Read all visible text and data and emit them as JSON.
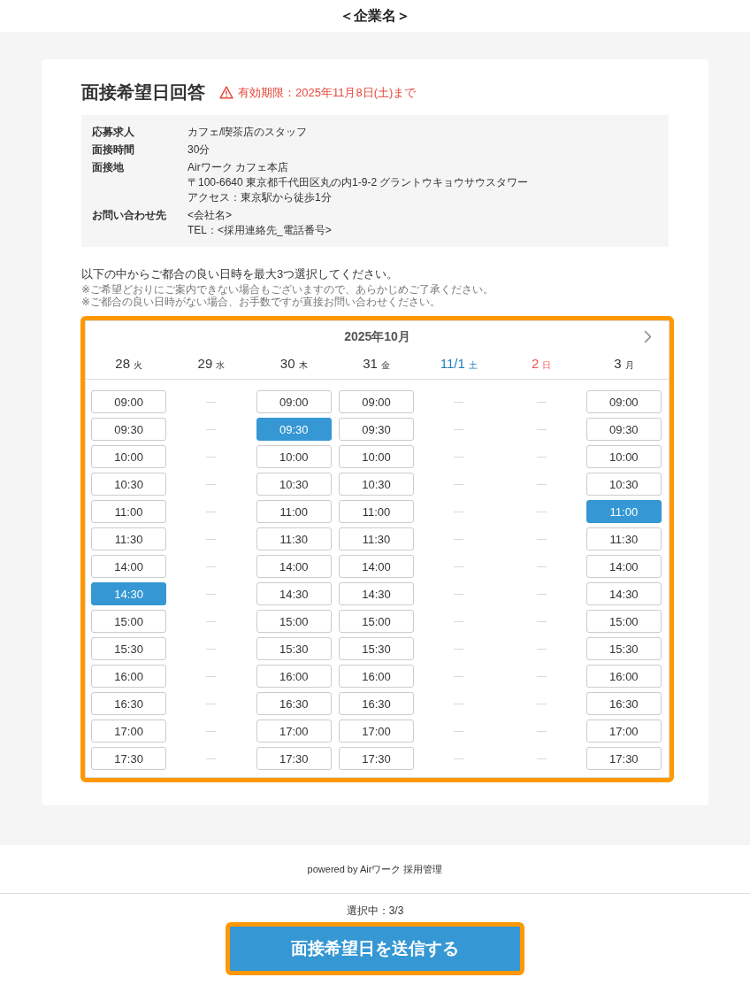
{
  "header": {
    "title": "＜企業名＞"
  },
  "form": {
    "title": "面接希望日回答",
    "deadline": "有効期限：2025年11月8日(土)まで",
    "details": [
      {
        "label": "応募求人",
        "lines": [
          "カフェ/喫茶店のスタッフ"
        ]
      },
      {
        "label": "面接時間",
        "lines": [
          "30分"
        ]
      },
      {
        "label": "面接地",
        "lines": [
          "Airワーク カフェ本店",
          "〒100-6640 東京都千代田区丸の内1-9-2 グラントウキョウサウスタワー",
          "アクセス：東京駅から徒歩1分"
        ]
      },
      {
        "label": "お問い合わせ先",
        "lines": [
          "<会社名>",
          "TEL：<採用連絡先_電話番号>"
        ]
      }
    ],
    "instruction": "以下の中からご都合の良い日時を最大3つ選択してください。",
    "notes": [
      "※ご希望どおりにご案内できない場合もございますので、あらかじめご了承ください。",
      "※ご都合の良い日時がない場合、お手数ですが直接お問い合わせください。"
    ],
    "calendar": {
      "highlighted": true,
      "month": "2025年10月",
      "days": [
        {
          "date": "28",
          "weekday": "火",
          "color": "#333333",
          "slots": [
            {
              "kind": "time",
              "time": "09:00",
              "selected": false
            },
            {
              "kind": "time",
              "time": "09:30",
              "selected": false
            },
            {
              "kind": "time",
              "time": "10:00",
              "selected": false
            },
            {
              "kind": "time",
              "time": "10:30",
              "selected": false
            },
            {
              "kind": "time",
              "time": "11:00",
              "selected": false
            },
            {
              "kind": "time",
              "time": "11:30",
              "selected": false
            },
            {
              "kind": "time",
              "time": "14:00",
              "selected": false
            },
            {
              "kind": "time",
              "time": "14:30",
              "selected": true
            },
            {
              "kind": "time",
              "time": "15:00",
              "selected": false
            },
            {
              "kind": "time",
              "time": "15:30",
              "selected": false
            },
            {
              "kind": "time",
              "time": "16:00",
              "selected": false
            },
            {
              "kind": "time",
              "time": "16:30",
              "selected": false
            },
            {
              "kind": "time",
              "time": "17:00",
              "selected": false
            },
            {
              "kind": "time",
              "time": "17:30",
              "selected": false
            }
          ]
        },
        {
          "date": "29",
          "weekday": "水",
          "color": "#333333",
          "slots": [
            {
              "kind": "none"
            },
            {
              "kind": "none"
            },
            {
              "kind": "none"
            },
            {
              "kind": "none"
            },
            {
              "kind": "none"
            },
            {
              "kind": "none"
            },
            {
              "kind": "none"
            },
            {
              "kind": "none"
            },
            {
              "kind": "none"
            },
            {
              "kind": "none"
            },
            {
              "kind": "none"
            },
            {
              "kind": "none"
            },
            {
              "kind": "none"
            },
            {
              "kind": "none"
            }
          ]
        },
        {
          "date": "30",
          "weekday": "木",
          "color": "#333333",
          "slots": [
            {
              "kind": "time",
              "time": "09:00",
              "selected": false
            },
            {
              "kind": "time",
              "time": "09:30",
              "selected": true
            },
            {
              "kind": "time",
              "time": "10:00",
              "selected": false
            },
            {
              "kind": "time",
              "time": "10:30",
              "selected": false
            },
            {
              "kind": "time",
              "time": "11:00",
              "selected": false
            },
            {
              "kind": "time",
              "time": "11:30",
              "selected": false
            },
            {
              "kind": "time",
              "time": "14:00",
              "selected": false
            },
            {
              "kind": "time",
              "time": "14:30",
              "selected": false
            },
            {
              "kind": "time",
              "time": "15:00",
              "selected": false
            },
            {
              "kind": "time",
              "time": "15:30",
              "selected": false
            },
            {
              "kind": "time",
              "time": "16:00",
              "selected": false
            },
            {
              "kind": "time",
              "time": "16:30",
              "selected": false
            },
            {
              "kind": "time",
              "time": "17:00",
              "selected": false
            },
            {
              "kind": "time",
              "time": "17:30",
              "selected": false
            }
          ]
        },
        {
          "date": "31",
          "weekday": "金",
          "color": "#333333",
          "slots": [
            {
              "kind": "time",
              "time": "09:00",
              "selected": false
            },
            {
              "kind": "time",
              "time": "09:30",
              "selected": false
            },
            {
              "kind": "time",
              "time": "10:00",
              "selected": false
            },
            {
              "kind": "time",
              "time": "10:30",
              "selected": false
            },
            {
              "kind": "time",
              "time": "11:00",
              "selected": false
            },
            {
              "kind": "time",
              "time": "11:30",
              "selected": false
            },
            {
              "kind": "time",
              "time": "14:00",
              "selected": false
            },
            {
              "kind": "time",
              "time": "14:30",
              "selected": false
            },
            {
              "kind": "time",
              "time": "15:00",
              "selected": false
            },
            {
              "kind": "time",
              "time": "15:30",
              "selected": false
            },
            {
              "kind": "time",
              "time": "16:00",
              "selected": false
            },
            {
              "kind": "time",
              "time": "16:30",
              "selected": false
            },
            {
              "kind": "time",
              "time": "17:00",
              "selected": false
            },
            {
              "kind": "time",
              "time": "17:30",
              "selected": false
            }
          ]
        },
        {
          "date": "11/1",
          "weekday": "土",
          "color": "#1f7cc0",
          "slots": [
            {
              "kind": "none"
            },
            {
              "kind": "none"
            },
            {
              "kind": "none"
            },
            {
              "kind": "none"
            },
            {
              "kind": "none"
            },
            {
              "kind": "none"
            },
            {
              "kind": "none"
            },
            {
              "kind": "none"
            },
            {
              "kind": "none"
            },
            {
              "kind": "none"
            },
            {
              "kind": "none"
            },
            {
              "kind": "none"
            },
            {
              "kind": "none"
            },
            {
              "kind": "none"
            }
          ]
        },
        {
          "date": "2",
          "weekday": "日",
          "color": "#ef5350",
          "slots": [
            {
              "kind": "none"
            },
            {
              "kind": "none"
            },
            {
              "kind": "none"
            },
            {
              "kind": "none"
            },
            {
              "kind": "none"
            },
            {
              "kind": "none"
            },
            {
              "kind": "none"
            },
            {
              "kind": "none"
            },
            {
              "kind": "none"
            },
            {
              "kind": "none"
            },
            {
              "kind": "none"
            },
            {
              "kind": "none"
            },
            {
              "kind": "none"
            },
            {
              "kind": "none"
            }
          ]
        },
        {
          "date": "3",
          "weekday": "月",
          "color": "#333333",
          "slots": [
            {
              "kind": "time",
              "time": "09:00",
              "selected": false
            },
            {
              "kind": "time",
              "time": "09:30",
              "selected": false
            },
            {
              "kind": "time",
              "time": "10:00",
              "selected": false
            },
            {
              "kind": "time",
              "time": "10:30",
              "selected": false
            },
            {
              "kind": "time",
              "time": "11:00",
              "selected": true
            },
            {
              "kind": "time",
              "time": "11:30",
              "selected": false
            },
            {
              "kind": "time",
              "time": "14:00",
              "selected": false
            },
            {
              "kind": "time",
              "time": "14:30",
              "selected": false
            },
            {
              "kind": "time",
              "time": "15:00",
              "selected": false
            },
            {
              "kind": "time",
              "time": "15:30",
              "selected": false
            },
            {
              "kind": "time",
              "time": "16:00",
              "selected": false
            },
            {
              "kind": "time",
              "time": "16:30",
              "selected": false
            },
            {
              "kind": "time",
              "time": "17:00",
              "selected": false
            },
            {
              "kind": "time",
              "time": "17:30",
              "selected": false
            }
          ]
        }
      ]
    }
  },
  "footer": {
    "powered_by": "powered by Airワーク 採用管理"
  },
  "submit_bar": {
    "selection_count": "選択中：3/3",
    "button": {
      "label": "面接希望日を送信する",
      "highlighted": true
    }
  }
}
